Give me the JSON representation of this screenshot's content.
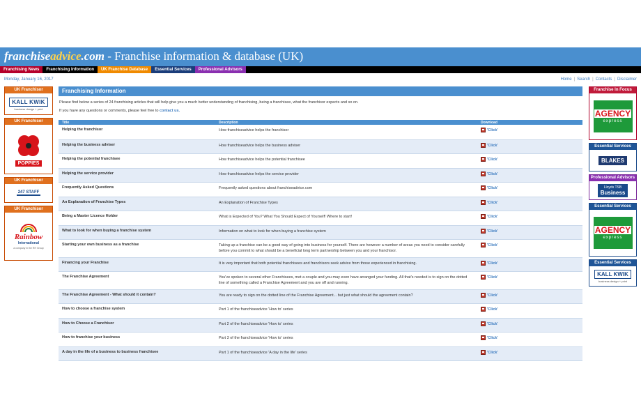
{
  "header": {
    "brand_part1": "franchise",
    "brand_part2": "advice",
    "brand_part3": ".com",
    "tagline": " - Franchise information & database (UK)"
  },
  "nav": [
    {
      "label": "Franchising News",
      "color": "#b5002a"
    },
    {
      "label": "Franchising Information",
      "color": "#000000"
    },
    {
      "label": "UK Franchise Database",
      "color": "#f08a00"
    },
    {
      "label": "Essential Services",
      "color": "#1a3d7a"
    },
    {
      "label": "Professional Advisors",
      "color": "#8a2fb0"
    }
  ],
  "date": "Monday, January 16, 2017",
  "toplinks": [
    "Home",
    "Search",
    "Contacts",
    "Disclaimer"
  ],
  "left_ads": [
    {
      "head": "UK Franchisor",
      "logo": "KALL KWIK",
      "sub": "business design + print"
    },
    {
      "head": "UK Franchisor",
      "logo": "POPPIES"
    },
    {
      "head": "UK Franchisor",
      "logo": "247 STAFF"
    },
    {
      "head": "UK Franchisor",
      "logo": "Rainbow",
      "sub": "International",
      "sub2": "a company in the RH Group"
    }
  ],
  "right_ads": [
    {
      "head": "Franchise In Focus",
      "logo": "AGENCY",
      "sub": "express"
    },
    {
      "head": "Essential Services",
      "logo": "BLAKES"
    },
    {
      "head": "Professional Advisors",
      "logo": "Lloyds TSB",
      "sub": "Business"
    },
    {
      "head": "Essential Services",
      "logo": "AGENCY",
      "sub": "express"
    },
    {
      "head": "Essential Services",
      "logo": "KALL KWIK",
      "sub": "business design + print"
    }
  ],
  "main": {
    "heading": "Franchising Information",
    "intro": "Please find below a series of 24 franchising articles that will help give you a much better understanding of franchising, being a franchisee, what the franchisor expects and so on.",
    "intro2_prefix": "If you have any questions or comments, please feel free to ",
    "intro2_link": "contact us.",
    "columns": [
      "Title",
      "Description",
      "Download"
    ],
    "download_label": "'Click'",
    "rows": [
      {
        "title": "Helping the franchisor",
        "desc": "How franchiseadvice helps the franchisor"
      },
      {
        "title": "Helping the business adviser",
        "desc": "How franchiseadvice helps the business adviser"
      },
      {
        "title": "Helping the potential franchisee",
        "desc": "How franchiseadvice helps the potential franchisee"
      },
      {
        "title": "Helping the service provider",
        "desc": "How franchiseadvice helps the service provider"
      },
      {
        "title": "Frequently Asked Questions",
        "desc": "Frequently asked questions about franchiseadvice.com"
      },
      {
        "title": "An Explanation of Franchise Types",
        "desc": "An Explanation of Franchise Types"
      },
      {
        "title": "Being a Master Licence Holder",
        "desc": "What is Expected of You? What You Should Expect of Yourself! Where to start!"
      },
      {
        "title": "What to look for when buying a franchise system",
        "desc": "Information on what to look for when buying a franchise system"
      },
      {
        "title": "Starting your own business as a franchise",
        "desc": "Taking up a franchise can be a good way of going into business for yourself. There are however a number of areas you need to consider carefully before you commit to what should be a beneficial long term partnership between you and your franchisor."
      },
      {
        "title": "Financing your Franchise",
        "desc": "It is very important that both potential franchisees and franchisors seek advice from those experienced in franchising."
      },
      {
        "title": "The Franchise Agreement",
        "desc": "You've spoken to several other Franchisees, met a couple and you may even have arranged your funding. All that's needed is to sign on the dotted line of something called a Franchise Agreement and you are off and running."
      },
      {
        "title": "The Franchise Agreement - What should it contain?",
        "desc": "You are ready to sign on the dotted line of the Franchise Agreement... but just what should the agreement contain?"
      },
      {
        "title": "How to choose a franchise system",
        "desc": "Part 1 of the franchiseadvice 'How to' series"
      },
      {
        "title": "How to Choose a Franchisor",
        "desc": "Part 2 of the franchiseadvice 'How to' series"
      },
      {
        "title": "How to franchise your business",
        "desc": "Part 3 of the franchiseadvice 'How to' series"
      },
      {
        "title": "A day in the life of a business to business franchisee",
        "desc": "Part 1 of the franchiseadvice 'A day in the life' series"
      }
    ]
  }
}
